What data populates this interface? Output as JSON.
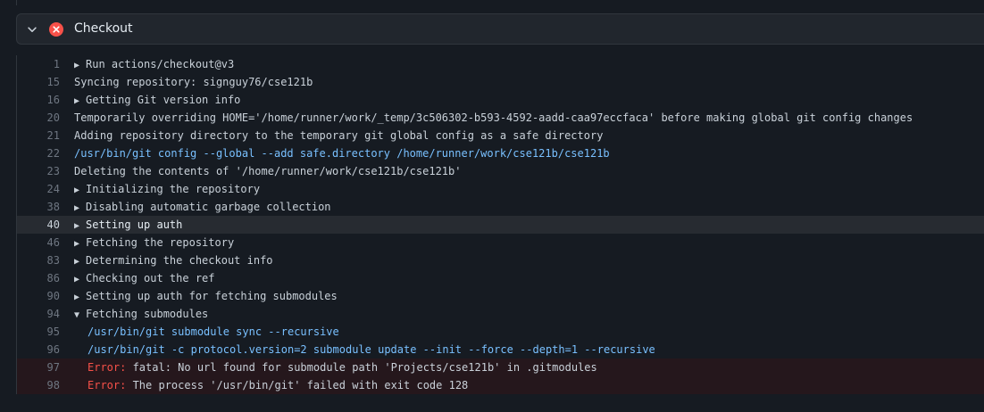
{
  "step": {
    "title": "Checkout"
  },
  "log_lines": [
    {
      "n": "1",
      "text": "Run actions/checkout@v3",
      "collapsible": "closed"
    },
    {
      "n": "15",
      "text": "Syncing repository: signguy76/cse121b"
    },
    {
      "n": "16",
      "text": "Getting Git version info",
      "collapsible": "closed"
    },
    {
      "n": "20",
      "text": "Temporarily overriding HOME='/home/runner/work/_temp/3c506302-b593-4592-aadd-caa97eccfaca' before making global git config changes"
    },
    {
      "n": "21",
      "text": "Adding repository directory to the temporary git global config as a safe directory"
    },
    {
      "n": "22",
      "text": "/usr/bin/git config --global --add safe.directory /home/runner/work/cse121b/cse121b",
      "kind": "cmd"
    },
    {
      "n": "23",
      "text": "Deleting the contents of '/home/runner/work/cse121b/cse121b'"
    },
    {
      "n": "24",
      "text": "Initializing the repository",
      "collapsible": "closed"
    },
    {
      "n": "38",
      "text": "Disabling automatic garbage collection",
      "collapsible": "closed"
    },
    {
      "n": "40",
      "text": "Setting up auth",
      "collapsible": "closed",
      "highlight": true
    },
    {
      "n": "46",
      "text": "Fetching the repository",
      "collapsible": "closed"
    },
    {
      "n": "83",
      "text": "Determining the checkout info",
      "collapsible": "closed"
    },
    {
      "n": "86",
      "text": "Checking out the ref",
      "collapsible": "closed"
    },
    {
      "n": "90",
      "text": "Setting up auth for fetching submodules",
      "collapsible": "closed"
    },
    {
      "n": "94",
      "text": "Fetching submodules",
      "collapsible": "open"
    },
    {
      "n": "95",
      "text": "/usr/bin/git submodule sync --recursive",
      "kind": "cmd",
      "indent": true
    },
    {
      "n": "96",
      "text": "/usr/bin/git -c protocol.version=2 submodule update --init --force --depth=1 --recursive",
      "kind": "cmd",
      "indent": true
    },
    {
      "n": "97",
      "error_label": "Error:",
      "text": " fatal: No url found for submodule path 'Projects/cse121b' in .gitmodules",
      "kind": "error",
      "indent": true
    },
    {
      "n": "98",
      "error_label": "Error:",
      "text": " The process '/usr/bin/git' failed with exit code 128",
      "kind": "error",
      "indent": true
    }
  ],
  "icons": {
    "chevron": "chevron-down-icon",
    "status": "x-circle-fill-icon",
    "triangle_closed": "triangle-right-icon",
    "triangle_open": "triangle-down-icon"
  },
  "colors": {
    "background": "#161b22",
    "header": "#21262d",
    "error": "#f85149",
    "command": "#79c0ff",
    "error_row": "#25171c"
  }
}
